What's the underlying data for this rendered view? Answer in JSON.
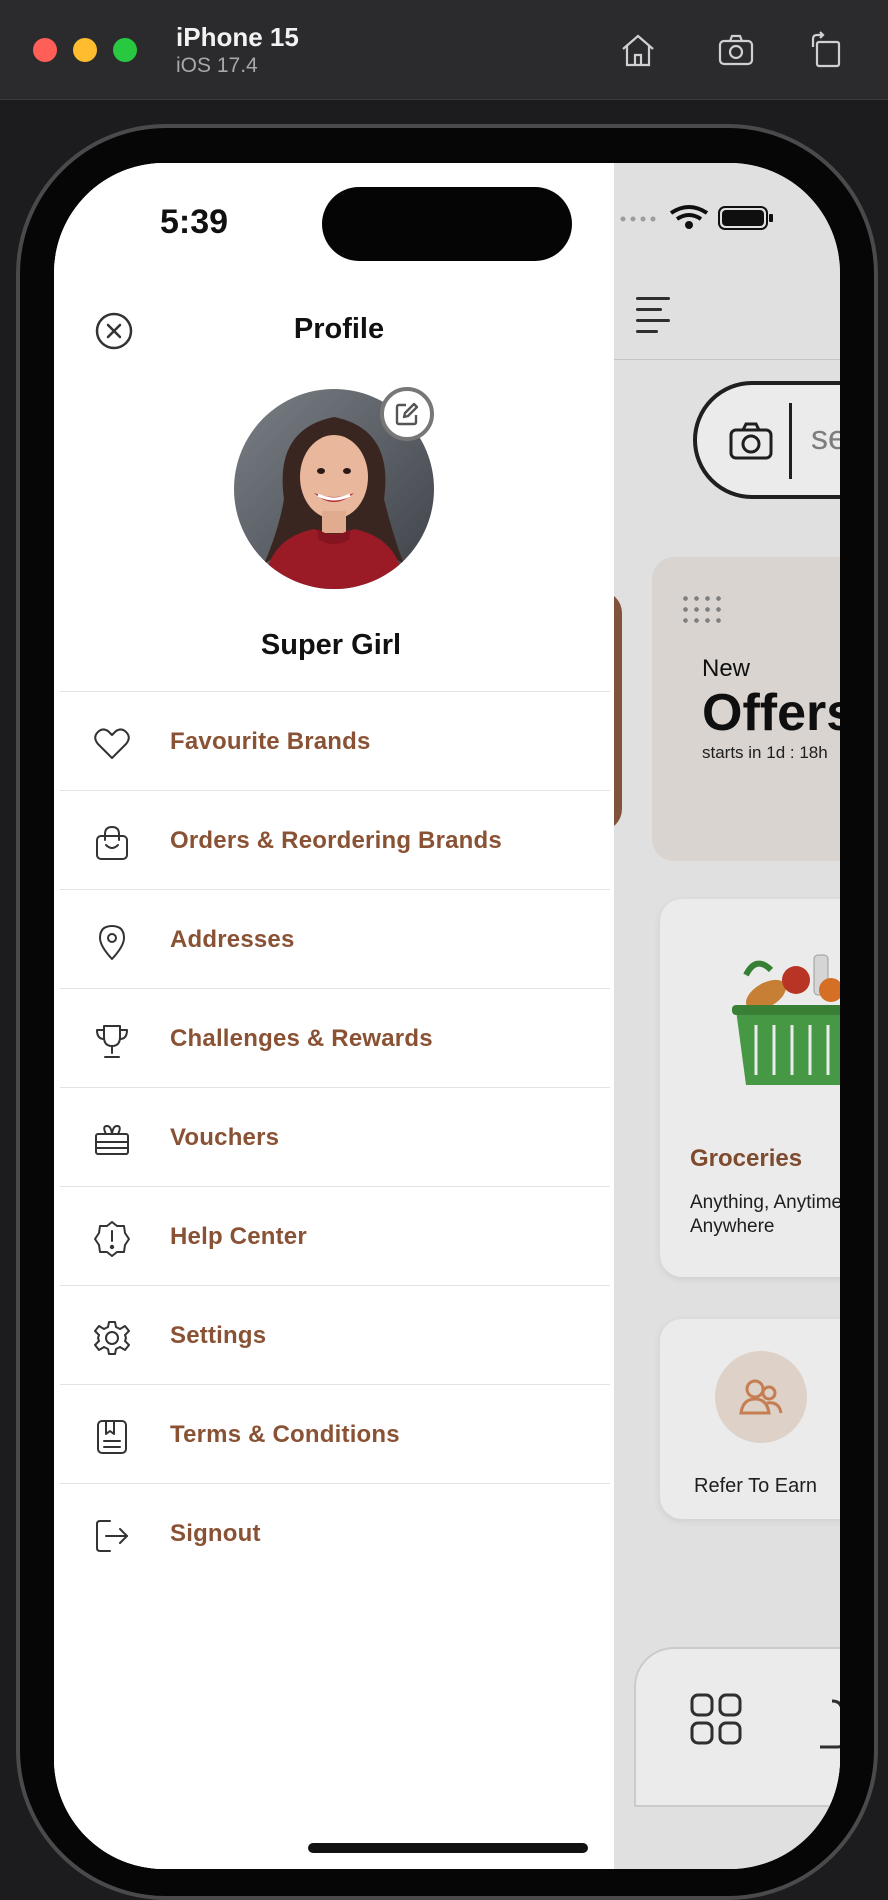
{
  "simulator": {
    "device_name": "iPhone 15",
    "os_version": "iOS 17.4",
    "buttons": [
      {
        "icon": "home-icon"
      },
      {
        "icon": "screenshot-icon"
      },
      {
        "icon": "rotate-icon"
      }
    ]
  },
  "status_bar": {
    "time": "5:39"
  },
  "drawer": {
    "title": "Profile",
    "user_name": "Super Girl",
    "menu": [
      {
        "label": "Favourite Brands",
        "icon": "heart-icon"
      },
      {
        "label": "Orders & Reordering Brands",
        "icon": "shopping-bag-icon"
      },
      {
        "label": "Addresses",
        "icon": "location-pin-icon"
      },
      {
        "label": "Challenges & Rewards",
        "icon": "trophy-icon"
      },
      {
        "label": "Vouchers",
        "icon": "gift-card-icon"
      },
      {
        "label": "Help Center",
        "icon": "help-badge-icon"
      },
      {
        "label": "Settings",
        "icon": "gear-icon"
      },
      {
        "label": "Terms & Conditions",
        "icon": "document-icon"
      },
      {
        "label": "Signout",
        "icon": "signout-icon"
      }
    ]
  },
  "background_app": {
    "search_placeholder": "se",
    "offer": {
      "new_label": "New",
      "title": "Offers",
      "starts": "starts in 1d : 18h"
    },
    "groceries": {
      "title": "Groceries",
      "subtitle": "Anything, Anytime, Anywhere"
    },
    "refer": {
      "label": "Refer To Earn"
    }
  },
  "colors": {
    "accent_brown": "#8a5234",
    "text_dark": "#111111",
    "divider": "#e3e3e3"
  }
}
